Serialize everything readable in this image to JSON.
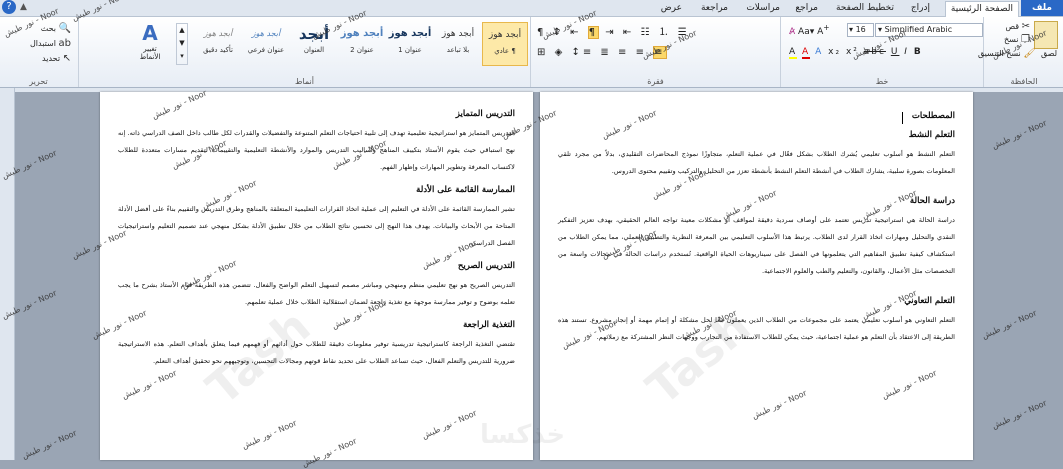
{
  "tabs": {
    "file": "ملف",
    "items": [
      "الصفحة الرئيسية",
      "إدراج",
      "تخطيط الصفحة",
      "مراجع",
      "مراسلات",
      "مراجعة",
      "عرض"
    ]
  },
  "clipboard": {
    "paste": "لصق",
    "cut": "قص",
    "copy": "نسخ",
    "format_painter": "نسخ التنسيق",
    "label": "الحافظة"
  },
  "font": {
    "name": "Simplified Arabic",
    "size": "16",
    "label": "خط"
  },
  "paragraph": {
    "label": "فقرة"
  },
  "styles": {
    "label": "أنماط",
    "tiles": [
      {
        "preview": "أبجد هوز",
        "name": "¶ عادي"
      },
      {
        "preview": "أبجد هوز",
        "name": "بلا تباعد"
      },
      {
        "preview": "أبجد هوز",
        "name": "عنوان 1"
      },
      {
        "preview": "أبجد هوز",
        "name": "عنوان 2"
      },
      {
        "preview": "أبجد",
        "name": "العنوان"
      },
      {
        "preview": "أبجد هوز",
        "name": "عنوان فرعي"
      },
      {
        "preview": "أبجد هوز",
        "name": "تأكيد دقيق"
      }
    ],
    "change_styles": "تغيير الأنماط"
  },
  "editing": {
    "find": "بحث",
    "replace": "استبدال",
    "select": "تحديد",
    "label": "تحرير"
  },
  "watermark_text": "نور طيش - Noor",
  "watermark_big": "Tash",
  "watermark_big_2": "خذكسا",
  "page_right": {
    "sections": [
      {
        "title": "المصطلحات",
        "paras": []
      },
      {
        "title": "التعلم النشط",
        "paras": [
          "التعلم النشط هو أسلوب تعليمي يُشرك الطلاب بشكل فعّال في عملية التعلم، متجاوزًا نموذج المحاضرات التقليدي، بدلاً من مجرد تلقي المعلومات بصورة سلبية، يشارك الطلاب في أنشطة التعلم النشط بأنشطة تعزز من التحليل والتركيب وتقييم محتوى الدروس."
        ]
      },
      {
        "title": "دراسة الحالة",
        "paras": [
          "دراسة الحالة هي استراتيجية تدريس تعتمد على أوصاف سردية دقيقة لمواقف أو مشكلات معينة تواجه العالم الحقيقي، بهدف تعزيز التفكير النقدي والتحليل ومهارات اتخاذ القرار لدى الطلاب. يرتبط هذا الأسلوب التعليمي بين المعرفة النظرية والتطبيق العملي، مما يمكن الطلاب من استكشاف كيفية تطبيق المفاهيم التي يتعلمونها في الفصل على سيناريوهات الحياة الواقعية. تُستخدم دراسات الحالة في مجالات واسعة من التخصصات مثل الأعمال، والقانون، والتعليم والطب والعلوم الاجتماعية."
        ]
      },
      {
        "title": "التعلم التعاوني",
        "paras": [
          "التعلم التعاوني هو أسلوب تعليمي يعتمد على مجموعات من الطلاب الذين يعملون معًا لحل مشكلة أو إتمام مهمة أو إنجاز مشروع. تستند هذه الطريقة إلى الاعتقاد بأن التعلم هو عملية اجتماعية، حيث يمكن للطلاب الاستفادة من التجارب ووجهات النظر المشتركة مع زملائهم."
        ]
      }
    ]
  },
  "page_left": {
    "sections": [
      {
        "title": "التدريس المتمايز",
        "paras": [
          "التدريس المتمايز هو استراتيجية تعليمية تهدف إلى تلبية احتياجات التعلم المتنوعة والتفضيلات والقدرات لكل طالب داخل الصف الدراسي ذاته. إنه نهج استباقي حيث يقوم الأستاذ بتكييف المناهج وأساليب التدريس والموارد والأنشطة التعليمية والتقييمات لتقديم مسارات متعددة للطلاب لاكتساب المعرفة وتطوير المهارات وإظهار الفهم."
        ]
      },
      {
        "title": "الممارسة القائمة على الأدلة",
        "paras": [
          "تشير الممارسة القائمة على الأدلة في التعليم إلى عملية اتخاذ القرارات التعليمية المتعلقة بالمناهج وطرق التدريس والتقييم بناءً على أفضل الأدلة المتاحة من الأبحاث والبيانات. يهدف هذا النهج إلى تحسين نتائج الطلاب من خلال تطبيق الأدلة بشكل منهجي عند تصميم التعليم واستراتيجيات الفصل الدراسي."
        ]
      },
      {
        "title": "التدريس الصريح",
        "paras": [
          "التدريس الصريح هو نهج تعليمي منظم ومنهجي ومباشر مصمم لتسهيل التعلم الواضح والفعال. تتضمن هذه الطريقة قيام الأستاذ بشرح ما يجب تعلمه بوضوح و توفير ممارسة موجهة مع تغذية راجعة لضمان استقلالية الطلاب خلال عملية تعلمهم."
        ]
      },
      {
        "title": "التغذية الراجعة",
        "paras": [
          "تقتضي التغذية الراجعة كاستراتيجية تدريسية توفير معلومات دقيقة للطلاب حول أدائهم أو فهمهم فيما يتعلق بأهداف التعلم. هذه الاستراتيجية ضرورية للتدريس والتعلم الفعال، حيث تساعد الطلاب على تحديد نقاط قوتهم ومجالات التحسين، وتوجيههم نحو تحقيق أهداف التعلم."
        ]
      }
    ]
  }
}
